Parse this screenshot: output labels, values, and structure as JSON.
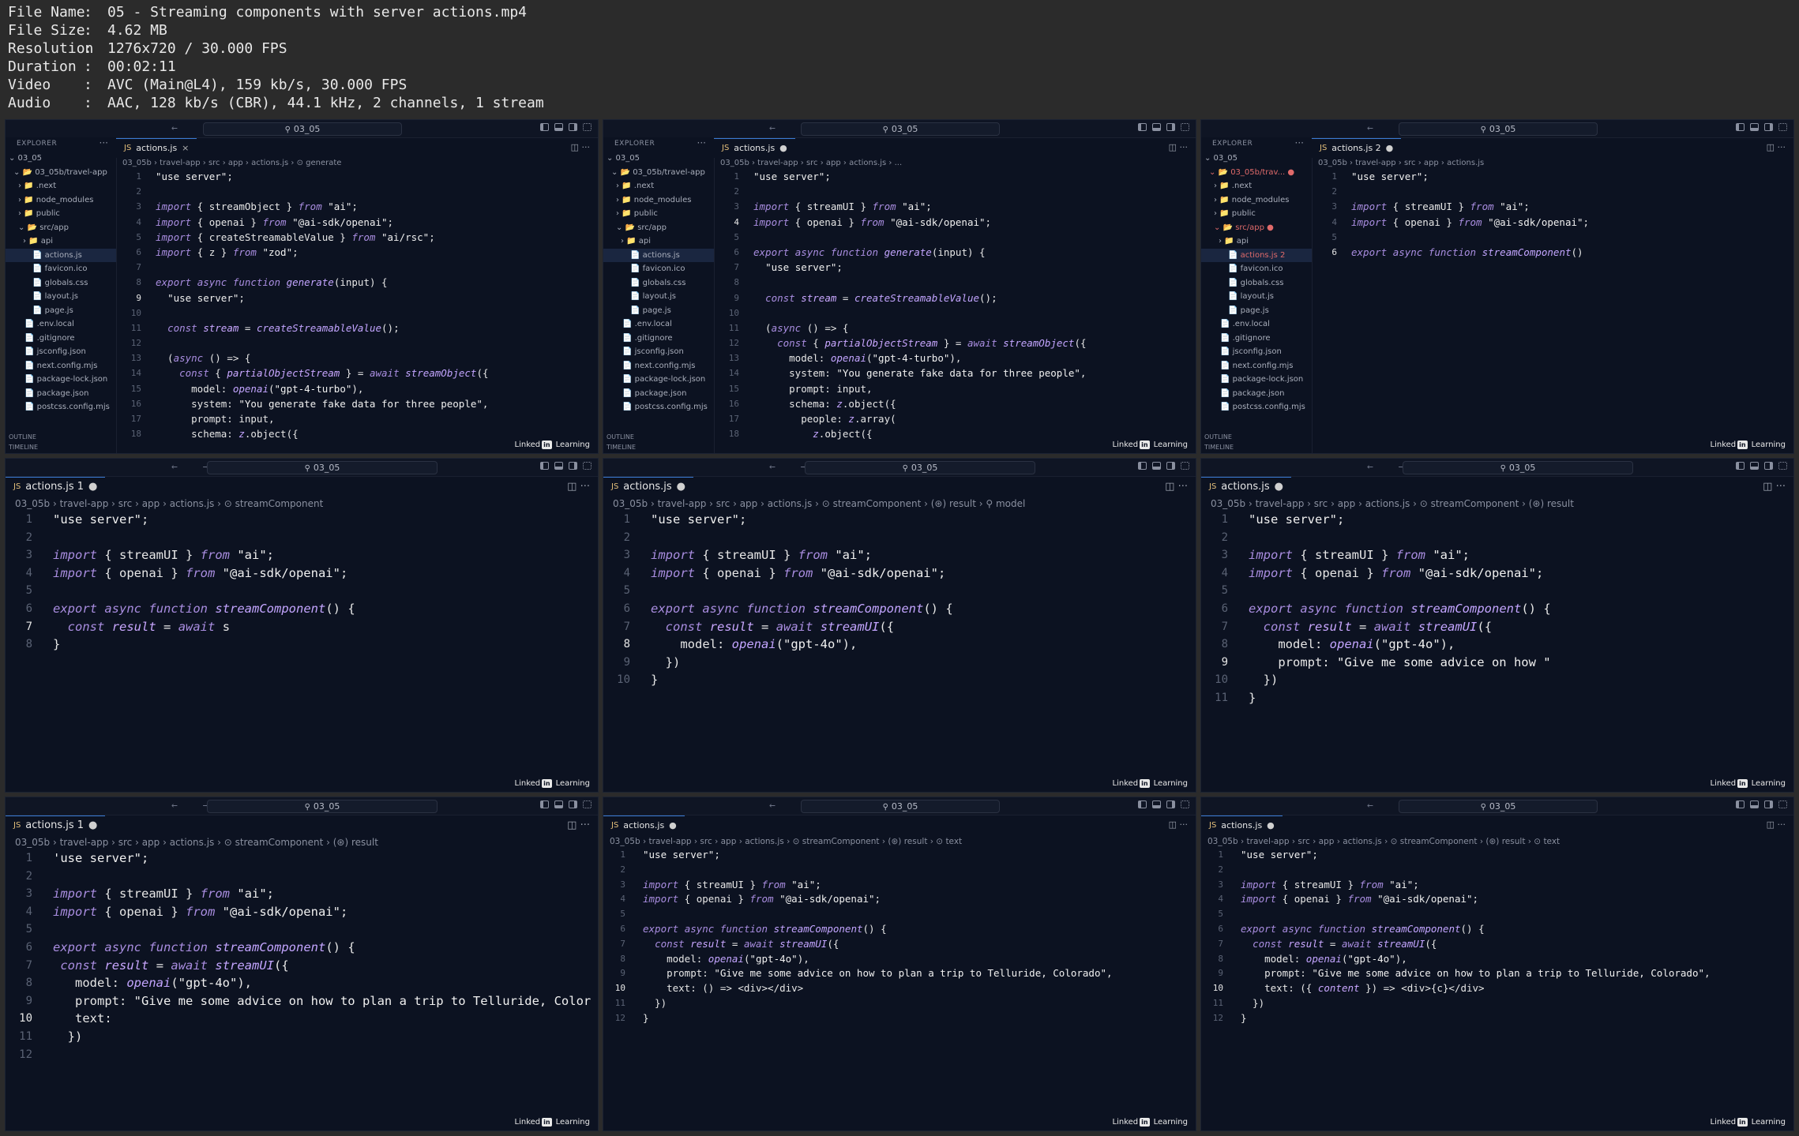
{
  "media_info": [
    {
      "key": "File Name",
      "value": "05 - Streaming components with server actions.mp4"
    },
    {
      "key": "File Size",
      "value": "4.62 MB"
    },
    {
      "key": "Resolution",
      "value": "1276x720 / 30.000 FPS"
    },
    {
      "key": "Duration",
      "value": "00:02:11"
    },
    {
      "key": "Video",
      "value": "AVC (Main@L4), 159 kb/s, 30.000 FPS"
    },
    {
      "key": "Audio",
      "value": "AAC, 128 kb/s (CBR), 44.1 kHz, 2 channels, 1 stream"
    }
  ],
  "info_separator": ":",
  "watermark": {
    "brand": "Linked",
    "in": "in",
    "suffix": "Learning"
  },
  "explorer": {
    "header": "EXPLORER",
    "outline": "OUTLINE",
    "timeline": "TIMELINE"
  },
  "panels": [
    {
      "kind": "small",
      "search": "03_05",
      "tab": {
        "name": "actions.js",
        "marker": "×"
      },
      "breadcrumb": "03_05b  ›  travel-app  ›  src  ›  app  ›  actions.js  ›  ⊙ generate",
      "explorer_items": [
        {
          "text": "⌄ 03_05",
          "indent": 4
        },
        {
          "text": "⌄ 📂 03_05b/travel-app",
          "indent": 10
        },
        {
          "text": "›  📁 .next",
          "indent": 16
        },
        {
          "text": "›  📁 node_modules",
          "indent": 16
        },
        {
          "text": "›  📁 public",
          "indent": 16
        },
        {
          "text": "⌄  📂 src/app",
          "indent": 16
        },
        {
          "text": "›  📁 api",
          "indent": 22
        },
        {
          "text": "📄 actions.js",
          "indent": 34,
          "sel": true
        },
        {
          "text": "📄 favicon.ico",
          "indent": 34
        },
        {
          "text": "📄 globals.css",
          "indent": 34
        },
        {
          "text": "📄 layout.js",
          "indent": 34
        },
        {
          "text": "📄 page.js",
          "indent": 34
        },
        {
          "text": "📄 .env.local",
          "indent": 24
        },
        {
          "text": "📄 .gitignore",
          "indent": 24
        },
        {
          "text": "📄 jsconfig.json",
          "indent": 24
        },
        {
          "text": "📄 next.config.mjs",
          "indent": 24
        },
        {
          "text": "📄 package-lock.json",
          "indent": 24
        },
        {
          "text": "📄 package.json",
          "indent": 24
        },
        {
          "text": "📄 postcss.config.mjs",
          "indent": 24
        }
      ],
      "current_line": 9,
      "lines": [
        "\"use server\";",
        "",
        "import { streamObject } from \"ai\";",
        "import { openai } from \"@ai-sdk/openai\";",
        "import { createStreamableValue } from \"ai/rsc\";",
        "import { z } from \"zod\";",
        "",
        "export async function generate(input) {",
        "  \"use server\";",
        "",
        "  const stream = createStreamableValue();",
        "",
        "  (async () => {",
        "    const { partialObjectStream } = await streamObject({",
        "      model: openai(\"gpt-4-turbo\"),",
        "      system: \"You generate fake data for three people\",",
        "      prompt: input,",
        "      schema: z.object({"
      ]
    },
    {
      "kind": "small",
      "search": "03_05",
      "tab": {
        "name": "actions.js",
        "marker": "●"
      },
      "breadcrumb": "03_05b  ›  travel-app  ›  src  ›  app  ›  actions.js  ›  ...",
      "explorer_items": [
        {
          "text": "⌄ 03_05",
          "indent": 4
        },
        {
          "text": "⌄ 📂 03_05b/travel-app",
          "indent": 10
        },
        {
          "text": "›  📁 .next",
          "indent": 16
        },
        {
          "text": "›  📁 node_modules",
          "indent": 16
        },
        {
          "text": "›  📁 public",
          "indent": 16
        },
        {
          "text": "⌄  📂 src/app",
          "indent": 16
        },
        {
          "text": "›  📁 api",
          "indent": 22
        },
        {
          "text": "📄 actions.js",
          "indent": 34,
          "sel": true
        },
        {
          "text": "📄 favicon.ico",
          "indent": 34
        },
        {
          "text": "📄 globals.css",
          "indent": 34
        },
        {
          "text": "📄 layout.js",
          "indent": 34
        },
        {
          "text": "📄 page.js",
          "indent": 34
        },
        {
          "text": "📄 .env.local",
          "indent": 24
        },
        {
          "text": "📄 .gitignore",
          "indent": 24
        },
        {
          "text": "📄 jsconfig.json",
          "indent": 24
        },
        {
          "text": "📄 next.config.mjs",
          "indent": 24
        },
        {
          "text": "📄 package-lock.json",
          "indent": 24
        },
        {
          "text": "📄 package.json",
          "indent": 24
        },
        {
          "text": "📄 postcss.config.mjs",
          "indent": 24
        }
      ],
      "current_line": 4,
      "lines": [
        "\"use server\";",
        "",
        "import { streamUI } from \"ai\";",
        "import { openai } from \"@ai-sdk/openai\";",
        "",
        "export async function generate(input) {",
        "  \"use server\";",
        "",
        "  const stream = createStreamableValue();",
        "",
        "  (async () => {",
        "    const { partialObjectStream } = await streamObject({",
        "      model: openai(\"gpt-4-turbo\"),",
        "      system: \"You generate fake data for three people\",",
        "      prompt: input,",
        "      schema: z.object({",
        "        people: z.array(",
        "          z.object({"
      ]
    },
    {
      "kind": "small",
      "search": "03_05",
      "tab": {
        "name": "actions.js 2",
        "marker": "●"
      },
      "breadcrumb": "03_05b  ›  travel-app  ›  src  ›  app  ›  actions.js",
      "explorer_items": [
        {
          "text": "⌄ 03_05",
          "indent": 4
        },
        {
          "text": "⌄ 📂 03_05b/trav...  ●",
          "indent": 10,
          "red": true
        },
        {
          "text": "›  📁 .next",
          "indent": 16
        },
        {
          "text": "›  📁 node_modules",
          "indent": 16
        },
        {
          "text": "›  📁 public",
          "indent": 16
        },
        {
          "text": "⌄  📂 src/app       ●",
          "indent": 16,
          "red": true
        },
        {
          "text": "›  📁 api",
          "indent": 22
        },
        {
          "text": "📄 actions.js      2",
          "indent": 34,
          "sel": true,
          "red": true
        },
        {
          "text": "📄 favicon.ico",
          "indent": 34
        },
        {
          "text": "📄 globals.css",
          "indent": 34
        },
        {
          "text": "📄 layout.js",
          "indent": 34
        },
        {
          "text": "📄 page.js",
          "indent": 34
        },
        {
          "text": "📄 .env.local",
          "indent": 24
        },
        {
          "text": "📄 .gitignore",
          "indent": 24
        },
        {
          "text": "📄 jsconfig.json",
          "indent": 24
        },
        {
          "text": "📄 next.config.mjs",
          "indent": 24
        },
        {
          "text": "📄 package-lock.json",
          "indent": 24
        },
        {
          "text": "📄 package.json",
          "indent": 24
        },
        {
          "text": "📄 postcss.config.mjs",
          "indent": 24
        }
      ],
      "current_line": 6,
      "lines": [
        "\"use server\";",
        "",
        "import { streamUI } from \"ai\";",
        "import { openai } from \"@ai-sdk/openai\";",
        "",
        "export async function streamComponent()"
      ]
    },
    {
      "kind": "large",
      "search": "03_05",
      "tab": {
        "name": "actions.js 1",
        "marker": "●"
      },
      "breadcrumb": "03_05b  ›  travel-app  ›  src  ›  app  ›  actions.js  ›  ⊙ streamComponent",
      "current_line": 7,
      "lines": [
        "\"use server\";",
        "",
        "import { streamUI } from \"ai\";",
        "import { openai } from \"@ai-sdk/openai\";",
        "",
        "export async function streamComponent() {",
        "  const result = await s",
        "}"
      ]
    },
    {
      "kind": "large",
      "search": "03_05",
      "tab": {
        "name": "actions.js",
        "marker": "●"
      },
      "breadcrumb": "03_05b  ›  travel-app  ›  src  ›  app  ›  actions.js  ›  ⊙ streamComponent  ›  (⊛) result  ›  ⚲ model",
      "current_line": 8,
      "lines": [
        "\"use server\";",
        "",
        "import { streamUI } from \"ai\";",
        "import { openai } from \"@ai-sdk/openai\";",
        "",
        "export async function streamComponent() {",
        "  const result = await streamUI({",
        "    model: openai(\"gpt-4o\"),",
        "  })",
        "}"
      ]
    },
    {
      "kind": "large",
      "search": "03_05",
      "tab": {
        "name": "actions.js",
        "marker": "●"
      },
      "breadcrumb": "03_05b  ›  travel-app  ›  src  ›  app  ›  actions.js  ›  ⊙ streamComponent  ›  (⊛) result",
      "current_line": 9,
      "lines": [
        "\"use server\";",
        "",
        "import { streamUI } from \"ai\";",
        "import { openai } from \"@ai-sdk/openai\";",
        "",
        "export async function streamComponent() {",
        "  const result = await streamUI({",
        "    model: openai(\"gpt-4o\"),",
        "    prompt: \"Give me some advice on how \"",
        "  })",
        "}"
      ]
    },
    {
      "kind": "large",
      "search": "03_05",
      "tab": {
        "name": "actions.js 1",
        "marker": "●"
      },
      "breadcrumb": "03_05b  ›  travel-app  ›  src  ›  app  ›  actions.js  ›  ⊙ streamComponent  ›  (⊛) result",
      "current_line": 10,
      "lines": [
        "'use server\";",
        "",
        "import { streamUI } from \"ai\";",
        "import { openai } from \"@ai-sdk/openai\";",
        "",
        "export async function streamComponent() {",
        " const result = await streamUI({",
        "   model: openai(\"gpt-4o\"),",
        "   prompt: \"Give me some advice on how to plan a trip to Telluride, Color",
        "   text: ",
        "  })",
        ""
      ]
    },
    {
      "kind": "wide",
      "search": "03_05",
      "tab": {
        "name": "actions.js",
        "marker": "●"
      },
      "breadcrumb": "03_05b  ›  travel-app  ›  src  ›  app  ›  actions.js  ›  ⊙ streamComponent  ›  (⊛) result  ›  ⊙ text",
      "current_line": 10,
      "lines": [
        "\"use server\";",
        "",
        "import { streamUI } from \"ai\";",
        "import { openai } from \"@ai-sdk/openai\";",
        "",
        "export async function streamComponent() {",
        "  const result = await streamUI({",
        "    model: openai(\"gpt-4o\"),",
        "    prompt: \"Give me some advice on how to plan a trip to Telluride, Colorado\",",
        "    text: () => <div></div>",
        "  })",
        "}"
      ]
    },
    {
      "kind": "wide",
      "search": "03_05",
      "tab": {
        "name": "actions.js",
        "marker": "●"
      },
      "breadcrumb": "03_05b  ›  travel-app  ›  src  ›  app  ›  actions.js  ›  ⊙ streamComponent  ›  (⊛) result  ›  ⊙ text",
      "current_line": 10,
      "lines": [
        "\"use server\";",
        "",
        "import { streamUI } from \"ai\";",
        "import { openai } from \"@ai-sdk/openai\";",
        "",
        "export async function streamComponent() {",
        "  const result = await streamUI({",
        "    model: openai(\"gpt-4o\"),",
        "    prompt: \"Give me some advice on how to plan a trip to Telluride, Colorado\",",
        "    text: ({ content }) => <div>{c}</div>",
        "  })",
        "}"
      ]
    }
  ]
}
